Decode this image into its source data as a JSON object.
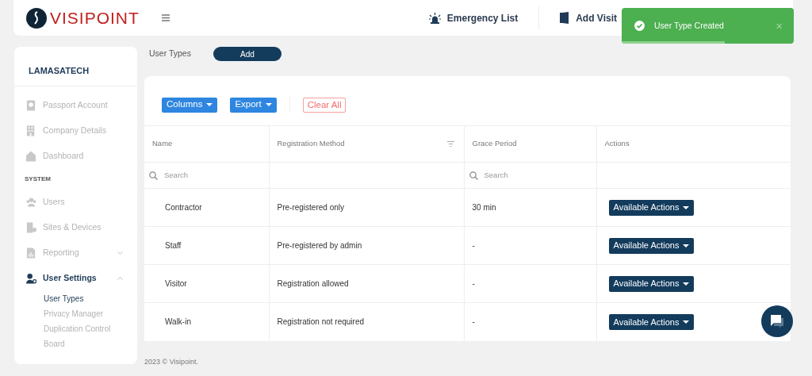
{
  "header": {
    "logo_text": "VISIPOINT",
    "links": [
      {
        "kind": "siren",
        "label": "Emergency List"
      },
      {
        "kind": "door",
        "label": "Add Visit"
      }
    ]
  },
  "toast": {
    "message": "User Type Created",
    "close": "×",
    "level": 0.6
  },
  "sidebar": {
    "org": "LAMASATECH",
    "items": [
      {
        "kind": "link",
        "label": "Passport Account",
        "selected": false
      },
      {
        "kind": "link",
        "label": "Company Details",
        "selected": false
      },
      {
        "kind": "link",
        "label": "Dashboard",
        "selected": false
      },
      {
        "kind": "heading",
        "label": "SYSTEM"
      },
      {
        "kind": "link",
        "label": "Users",
        "selected": false
      },
      {
        "kind": "link",
        "label": "Sites & Devices",
        "selected": false
      },
      {
        "kind": "group",
        "label": "Reporting",
        "selected": false,
        "expanded": false
      },
      {
        "kind": "group",
        "label": "User Settings",
        "selected": true,
        "expanded": true,
        "children": [
          {
            "label": "User Types",
            "selected": true
          },
          {
            "label": "Privacy Manager",
            "selected": false
          },
          {
            "label": "Duplication Control Board",
            "selected": false
          }
        ]
      }
    ]
  },
  "page": {
    "title": "User Types",
    "add_button": "Add"
  },
  "toolbar": {
    "columns_button": "Columns",
    "export_button": "Export",
    "clear_button": "Clear All"
  },
  "table": {
    "columns": [
      {
        "label": "Name",
        "placeholder": "Search"
      },
      {
        "label": "Registration Method"
      },
      {
        "label": "Grace Period",
        "placeholder": "Search"
      },
      {
        "label": "Actions"
      }
    ],
    "rows": [
      {
        "name": "Contractor",
        "method": "Pre-registered only",
        "grace": "30 min",
        "action": "Available Actions"
      },
      {
        "name": "Staff",
        "method": "Pre-registered by admin",
        "grace": "-",
        "action": "Available Actions"
      },
      {
        "name": "Visitor",
        "method": "Registration allowed",
        "grace": "-",
        "action": "Available Actions"
      },
      {
        "name": "Walk-in",
        "method": "Registration not required",
        "grace": "-",
        "action": "Available Actions"
      }
    ]
  },
  "footer": "2023 © Visipoint."
}
